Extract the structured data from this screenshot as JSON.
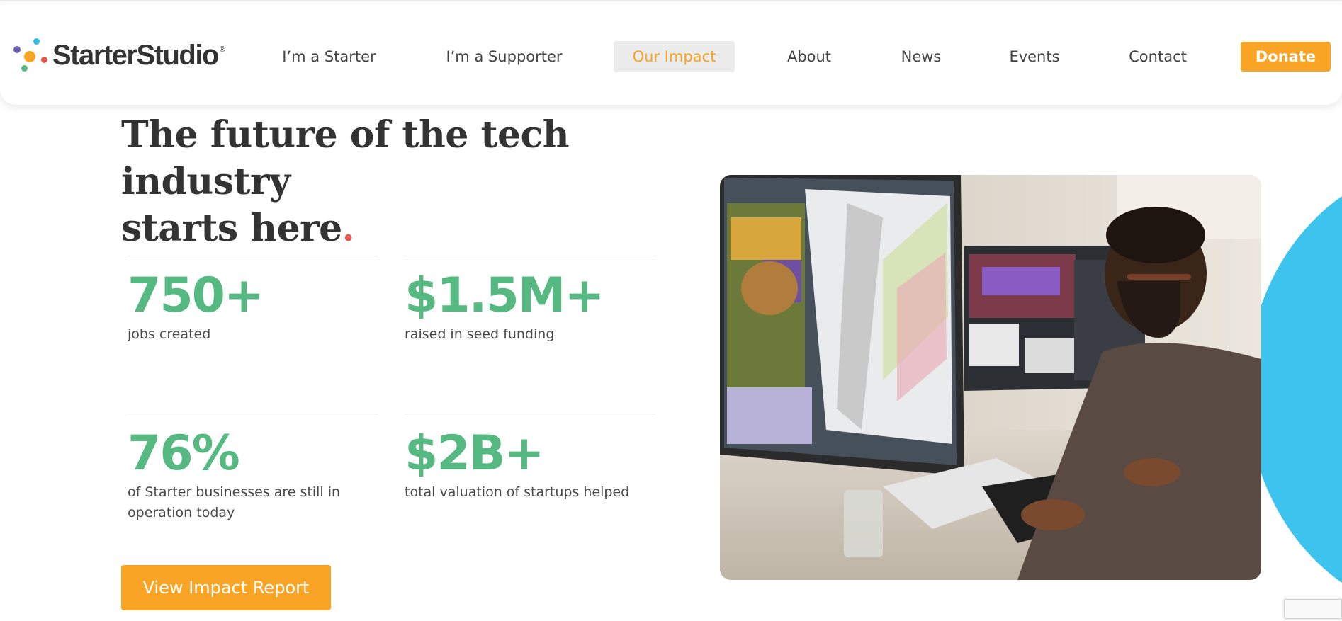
{
  "header": {
    "logo_text": "StarterStudio",
    "logo_reg": "®",
    "nav": [
      {
        "label": "I’m a Starter"
      },
      {
        "label": "I’m a Supporter"
      },
      {
        "label": "Our Impact",
        "active": true
      },
      {
        "label": "About"
      },
      {
        "label": "News"
      },
      {
        "label": "Events"
      },
      {
        "label": "Contact"
      }
    ],
    "donate_label": "Donate"
  },
  "hero": {
    "headline_line1": "The future of the tech industry",
    "headline_line2": "starts here",
    "headline_dot": "."
  },
  "stats": [
    {
      "value": "750+",
      "label": "jobs created"
    },
    {
      "value": "$1.5M+",
      "label": "raised in seed funding"
    },
    {
      "value": "76%",
      "label": "of Starter businesses are still in operation today"
    },
    {
      "value": "$2B+",
      "label": "total valuation of startups helped"
    }
  ],
  "cta": {
    "label": "View Impact Report"
  },
  "colors": {
    "brand_orange": "#f9a424",
    "stat_green": "#55b981",
    "accent_blue": "#3cc3ee",
    "accent_red": "#e5584e",
    "text_dark": "#333333"
  },
  "icons": {
    "logo_mark": "starterstudio-dots-logo-icon",
    "recaptcha": "recaptcha-badge-icon"
  }
}
